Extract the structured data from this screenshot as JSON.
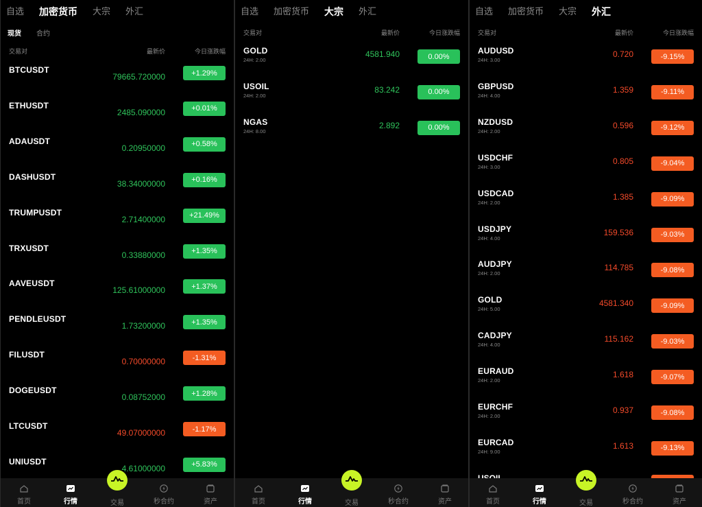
{
  "colors": {
    "up": "#29c15a",
    "down": "#f45c22",
    "accent": "#c8f426",
    "background": "#000000"
  },
  "headers": {
    "pair": "交易对",
    "price": "最新价",
    "change": "今日涨跌幅"
  },
  "panels": [
    {
      "tabs": [
        {
          "label": "自选",
          "active": false
        },
        {
          "label": "加密货币",
          "active": true
        },
        {
          "label": "大宗",
          "active": false
        },
        {
          "label": "外汇",
          "active": false
        }
      ],
      "sub_tabs": [
        {
          "label": "现货",
          "active": true
        },
        {
          "label": "合约",
          "active": false
        }
      ],
      "rows": [
        {
          "symbol": "BTCUSDT",
          "sub": "",
          "price": "79665.720000",
          "change": "+1.29%",
          "dir": "up"
        },
        {
          "symbol": "ETHUSDT",
          "sub": "",
          "price": "2485.090000",
          "change": "+0.01%",
          "dir": "up"
        },
        {
          "symbol": "ADAUSDT",
          "sub": "",
          "price": "0.20950000",
          "change": "+0.58%",
          "dir": "up"
        },
        {
          "symbol": "DASHUSDT",
          "sub": "",
          "price": "38.34000000",
          "change": "+0.16%",
          "dir": "up"
        },
        {
          "symbol": "TRUMPUSDT",
          "sub": "",
          "price": "2.71400000",
          "change": "+21.49%",
          "dir": "up"
        },
        {
          "symbol": "TRXUSDT",
          "sub": "",
          "price": "0.33880000",
          "change": "+1.35%",
          "dir": "up"
        },
        {
          "symbol": "AAVEUSDT",
          "sub": "",
          "price": "125.61000000",
          "change": "+1.37%",
          "dir": "up"
        },
        {
          "symbol": "PENDLEUSDT",
          "sub": "",
          "price": "1.73200000",
          "change": "+1.35%",
          "dir": "up"
        },
        {
          "symbol": "FILUSDT",
          "sub": "",
          "price": "0.70000000",
          "change": "-1.31%",
          "dir": "down"
        },
        {
          "symbol": "DOGEUSDT",
          "sub": "",
          "price": "0.08752000",
          "change": "+1.28%",
          "dir": "up"
        },
        {
          "symbol": "LTCUSDT",
          "sub": "",
          "price": "49.07000000",
          "change": "-1.17%",
          "dir": "down"
        },
        {
          "symbol": "UNIUSDT",
          "sub": "",
          "price": "4.61000000",
          "change": "+5.83%",
          "dir": "up"
        }
      ]
    },
    {
      "tabs": [
        {
          "label": "自选",
          "active": false
        },
        {
          "label": "加密货币",
          "active": false
        },
        {
          "label": "大宗",
          "active": true
        },
        {
          "label": "外汇",
          "active": false
        }
      ],
      "sub_tabs": [],
      "rows": [
        {
          "symbol": "GOLD",
          "sub": "24H: 2.00",
          "price": "4581.940",
          "change": "0.00%",
          "dir": "up"
        },
        {
          "symbol": "USOIL",
          "sub": "24H: 2.00",
          "price": "83.242",
          "change": "0.00%",
          "dir": "up"
        },
        {
          "symbol": "NGAS",
          "sub": "24H: 8.00",
          "price": "2.892",
          "change": "0.00%",
          "dir": "up"
        }
      ]
    },
    {
      "tabs": [
        {
          "label": "自选",
          "active": false
        },
        {
          "label": "加密货币",
          "active": false
        },
        {
          "label": "大宗",
          "active": false
        },
        {
          "label": "外汇",
          "active": true
        }
      ],
      "sub_tabs": [],
      "rows": [
        {
          "symbol": "AUDUSD",
          "sub": "24H: 3.00",
          "price": "0.720",
          "change": "-9.15%",
          "dir": "down"
        },
        {
          "symbol": "GBPUSD",
          "sub": "24H: 4.00",
          "price": "1.359",
          "change": "-9.11%",
          "dir": "down"
        },
        {
          "symbol": "NZDUSD",
          "sub": "24H: 2.00",
          "price": "0.596",
          "change": "-9.12%",
          "dir": "down"
        },
        {
          "symbol": "USDCHF",
          "sub": "24H: 3.00",
          "price": "0.805",
          "change": "-9.04%",
          "dir": "down"
        },
        {
          "symbol": "USDCAD",
          "sub": "24H: 2.00",
          "price": "1.385",
          "change": "-9.09%",
          "dir": "down"
        },
        {
          "symbol": "USDJPY",
          "sub": "24H: 4.00",
          "price": "159.536",
          "change": "-9.03%",
          "dir": "down"
        },
        {
          "symbol": "AUDJPY",
          "sub": "24H: 2.00",
          "price": "114.785",
          "change": "-9.08%",
          "dir": "down"
        },
        {
          "symbol": "GOLD",
          "sub": "24H: 5.00",
          "price": "4581.340",
          "change": "-9.09%",
          "dir": "down"
        },
        {
          "symbol": "CADJPY",
          "sub": "24H: 4.00",
          "price": "115.162",
          "change": "-9.03%",
          "dir": "down"
        },
        {
          "symbol": "EURAUD",
          "sub": "24H: 2.00",
          "price": "1.618",
          "change": "-9.07%",
          "dir": "down"
        },
        {
          "symbol": "EURCHF",
          "sub": "24H: 2.00",
          "price": "0.937",
          "change": "-9.08%",
          "dir": "down"
        },
        {
          "symbol": "EURCAD",
          "sub": "24H: 9.00",
          "price": "1.613",
          "change": "-9.13%",
          "dir": "down"
        }
      ],
      "cut_row": {
        "symbol": "USOIL"
      }
    }
  ],
  "nav": [
    {
      "label": "首页",
      "icon": "home-icon",
      "active": false
    },
    {
      "label": "行情",
      "icon": "market-chart-icon",
      "active": true
    },
    {
      "label": "交易",
      "icon": "trade-icon",
      "active": false
    },
    {
      "label": "秒合约",
      "icon": "lightning-icon",
      "active": false
    },
    {
      "label": "资产",
      "icon": "wallet-icon",
      "active": false
    }
  ]
}
